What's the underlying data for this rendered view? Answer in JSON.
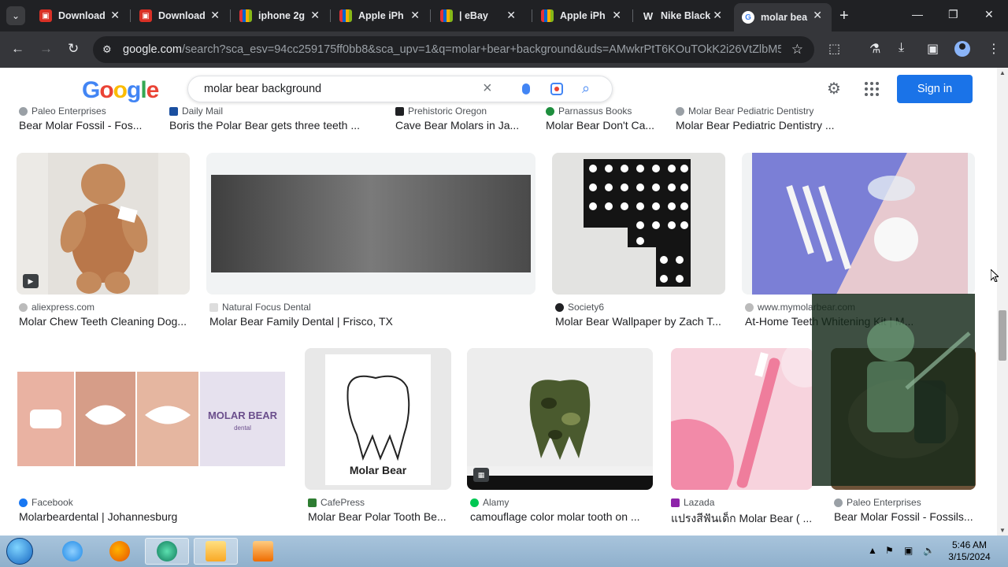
{
  "browser": {
    "tabs": [
      {
        "title": "Download",
        "favicon_color": "#d93025"
      },
      {
        "title": "Download",
        "favicon_color": "#d93025"
      },
      {
        "title": "iphone 2g",
        "favicon_color": "#e53238"
      },
      {
        "title": "Apple iPh",
        "favicon_color": "#e53238"
      },
      {
        "title": "| eBay",
        "favicon_color": "#e53238"
      },
      {
        "title": "Apple iPh",
        "favicon_color": "#e53238"
      },
      {
        "title": "Nike Black",
        "favicon_color": "#5f6368"
      },
      {
        "title": "molar bea",
        "favicon_color": "#4285f4"
      }
    ],
    "url_host": "google.com",
    "url_rest": "/search?sca_esv=94cc259175ff0bb8&sca_upv=1&q=molar+bear+background&uds=AMwkrPtT6KOuTOkK2i26VtZlbM5JH..."
  },
  "google": {
    "logo": "Google",
    "query": "molar bear background",
    "signin_label": "Sign in"
  },
  "results_top": [
    {
      "source": "Paleo Enterprises",
      "title": "Bear Molar Fossil - Fos..."
    },
    {
      "source": "Daily Mail",
      "title": "Boris the Polar Bear gets three teeth ..."
    },
    {
      "source": "Prehistoric Oregon",
      "title": "Cave Bear Molars in Ja..."
    },
    {
      "source": "Parnassus Books",
      "title": "Molar Bear Don't Ca..."
    },
    {
      "source": "Molar Bear Pediatric Dentistry",
      "title": "Molar Bear Pediatric Dentistry ..."
    }
  ],
  "results_row2": [
    {
      "source": "aliexpress.com",
      "title": "Molar Chew Teeth Cleaning Dog..."
    },
    {
      "source": "Natural Focus Dental",
      "title": "Molar Bear Family Dental | Frisco, TX"
    },
    {
      "source": "Society6",
      "title": "Molar Bear Wallpaper by Zach T..."
    },
    {
      "source": "www.mymolarbear.com",
      "title": "At-Home Teeth Whitening Kit | M..."
    }
  ],
  "results_row3": [
    {
      "source": "Facebook",
      "title": "Molarbeardental | Johannesburg"
    },
    {
      "source": "CafePress",
      "title": "Molar Bear Polar Tooth Be..."
    },
    {
      "source": "Alamy",
      "title": "camouflage color molar tooth on ..."
    },
    {
      "source": "Lazada",
      "title": "แปรงสีฟันเด็ก Molar Bear ( ..."
    },
    {
      "source": "Paleo Enterprises",
      "title": "Bear Molar Fossil - Fossils..."
    }
  ],
  "image_text": {
    "molar_bear_dental_logo": "MOLAR BEAR",
    "molar_bear_dental_sub": "dental",
    "polar_tooth_text": "Molar Bear"
  },
  "taskbar": {
    "time": "5:46 AM",
    "date": "3/15/2024"
  }
}
